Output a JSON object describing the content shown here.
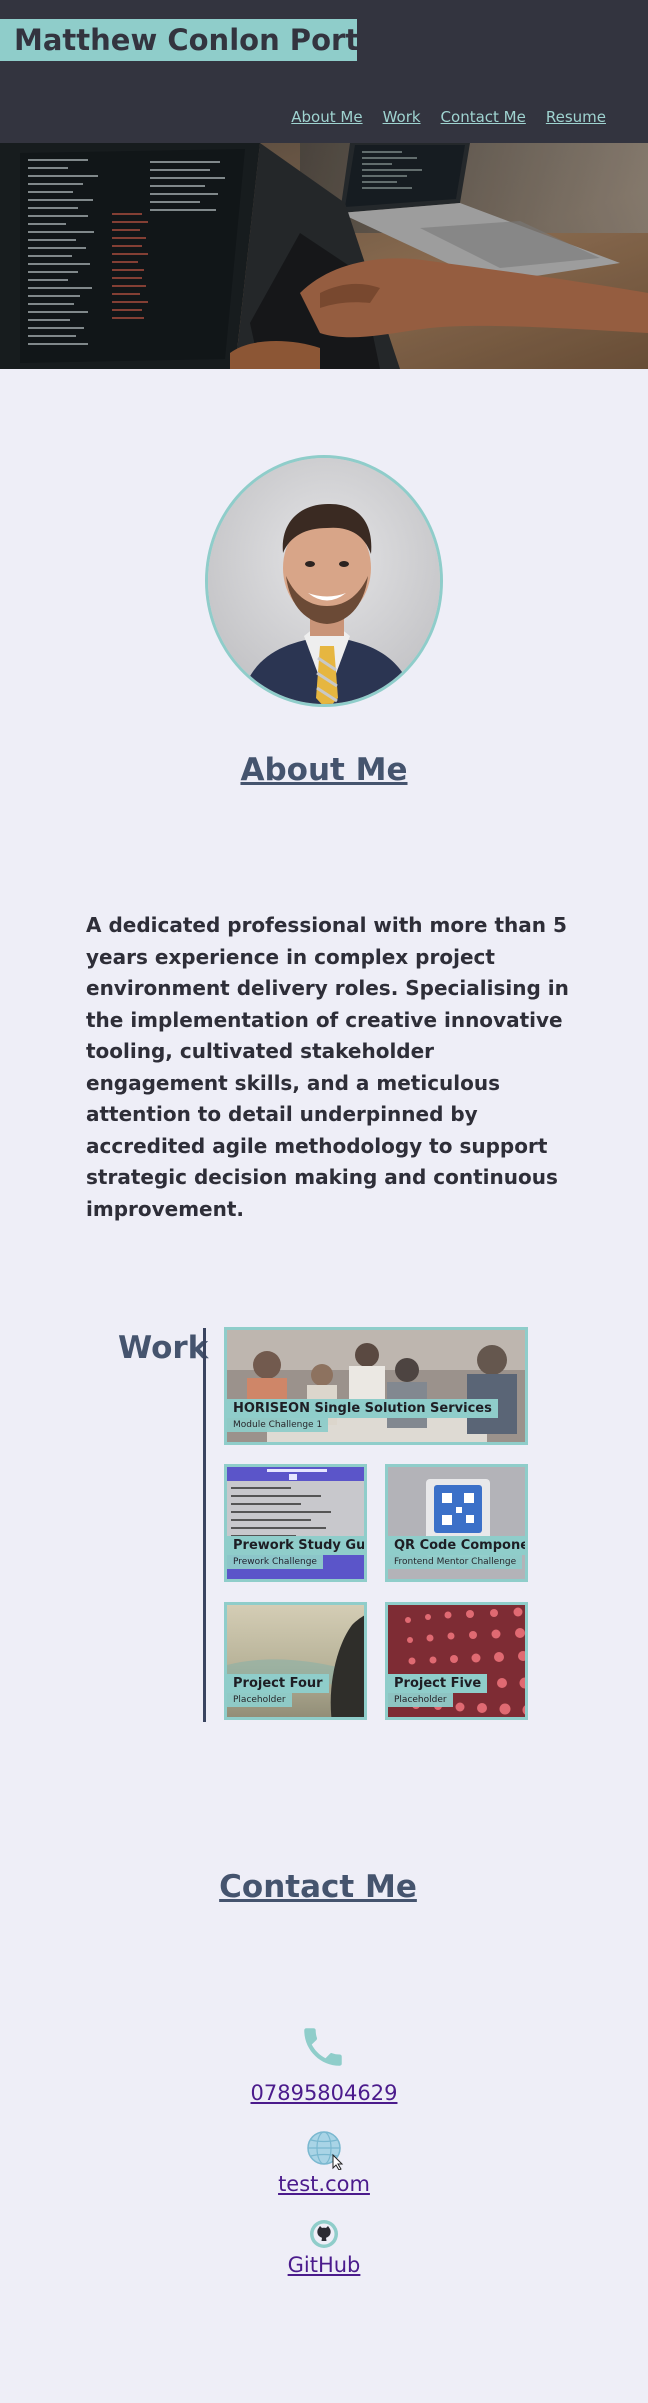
{
  "header": {
    "title": "Matthew Conlon Portfolio",
    "nav": [
      "About Me",
      "Work",
      "Contact Me",
      "Resume"
    ]
  },
  "about": {
    "heading": "About Me",
    "text": "A dedicated professional with more than 5 years experience in complex project environment delivery roles. Specialising in the implementation of creative innovative tooling, cultivated stakeholder engagement skills, and a meticulous attention to detail underpinned by accredited agile methodology to support strategic decision making and continuous improvement."
  },
  "work": {
    "heading": "Work",
    "projects": [
      {
        "title": "HORISEON Single Solution Services",
        "subtitle": "Module Challenge 1"
      },
      {
        "title": "Prework Study Guide",
        "subtitle": "Prework Challenge"
      },
      {
        "title": "QR Code Component",
        "subtitle": "Frontend Mentor Challenge"
      },
      {
        "title": "Project Four",
        "subtitle": "Placeholder"
      },
      {
        "title": "Project Five",
        "subtitle": "Placeholder"
      }
    ]
  },
  "contact": {
    "heading": "Contact Me",
    "phone": "07895804629",
    "website": "test.com",
    "github": "GitHub"
  },
  "colors": {
    "header_bg": "#33343f",
    "accent": "#8fcdca",
    "page_bg": "#eeeef7",
    "heading": "#45546e",
    "link": "#4b1b8c"
  },
  "icons": [
    "phone-icon",
    "globe-icon",
    "github-icon"
  ]
}
